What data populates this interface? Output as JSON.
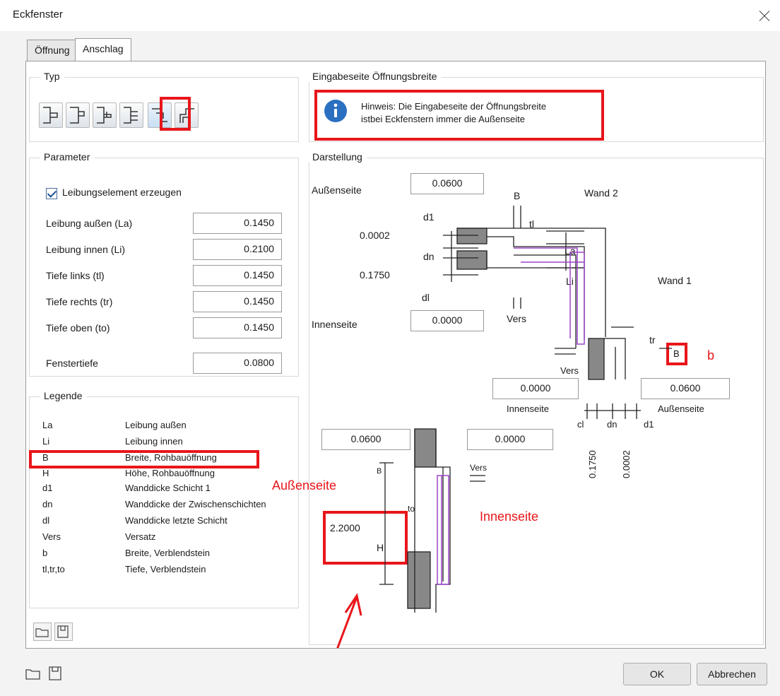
{
  "window": {
    "title": "Eckfenster"
  },
  "tabs": [
    {
      "label": "Öffnung"
    },
    {
      "label": "Anschlag"
    }
  ],
  "groups": {
    "typ": "Typ",
    "parameter": "Parameter",
    "legende": "Legende",
    "eingabe": "Eingabeseite Öffnungsbreite",
    "darstellung": "Darstellung"
  },
  "hint": {
    "line1": "Hinweis: Die Eingabeseite der Öffnungsbreite",
    "line2": "istbei Eckfenstern immer die Außenseite"
  },
  "parameter": {
    "checkbox_label": "Leibungselement erzeugen",
    "rows": [
      {
        "label": "Leibung außen (La)",
        "value": "0.1450"
      },
      {
        "label": "Leibung innen (Li)",
        "value": "0.2100"
      },
      {
        "label": "Tiefe links  (tl)",
        "value": "0.1450"
      },
      {
        "label": "Tiefe rechts  (tr)",
        "value": "0.1450"
      },
      {
        "label": "Tiefe oben    (to)",
        "value": "0.1450"
      },
      {
        "label": "Fenstertiefe",
        "value": "0.0800"
      }
    ]
  },
  "legend": [
    {
      "key": "La",
      "value": "Leibung außen"
    },
    {
      "key": "Li",
      "value": "Leibung innen"
    },
    {
      "key": "B",
      "value": "Breite, Rohbauöffnung"
    },
    {
      "key": "H",
      "value": "Höhe, Rohbauöffnung"
    },
    {
      "key": "d1",
      "value": "Wanddicke Schicht 1"
    },
    {
      "key": "dn",
      "value": "Wanddicke der Zwischenschichten"
    },
    {
      "key": "dl",
      "value": "Wanddicke letzte Schicht"
    },
    {
      "key": "Vers",
      "value": "Versatz"
    },
    {
      "key": "b",
      "value": "Breite, Verblendstein"
    },
    {
      "key": "tl,tr,to",
      "value": "Tiefe, Verblendstein"
    }
  ],
  "drawing": {
    "aussenseite_label": "Außenseite",
    "aussenseite_value": "0.0600",
    "innenseite_label": "Innenseite",
    "innenseite_value": "0.0000",
    "d1_value": "0.0002",
    "dn_value": "0.1750",
    "wand1": "Wand 2",
    "wand2": "Wand 1",
    "lbl_B": "B",
    "lbl_tl": "tl",
    "lbl_d1": "d1",
    "lbl_dn": "dn",
    "lbl_dl": "dl",
    "lbl_La": "La",
    "lbl_Li": "Li",
    "lbl_Vers": "Vers",
    "lbl_tr": "tr",
    "lbl_B2": "B",
    "lbl_vers2": "Vers",
    "bottom_left_value": "0.0000",
    "bottom_right_value": "0.0600",
    "bottom_innen": "Innenseite",
    "bottom_aussen": "Außenseite",
    "bottom_cl": "cl",
    "bottom_dn": "dn",
    "bottom_d1": "d1",
    "rot_1750": "0.1750",
    "rot_0002": "0.0002",
    "sec_left_value": "0.0600",
    "sec_right_value": "0.0000",
    "sec_B": "B",
    "sec_to": "to",
    "sec_vers": "Vers",
    "sec_H": "H",
    "sec_height_value": "2.2000"
  },
  "annotations": {
    "b": "b",
    "aussenseite": "Außenseite",
    "innenseite": "Innenseite"
  },
  "buttons": {
    "ok": "OK",
    "cancel": "Abbrechen"
  },
  "colors": {
    "highlight": "#e8161b",
    "accent": "#9b45c9"
  }
}
